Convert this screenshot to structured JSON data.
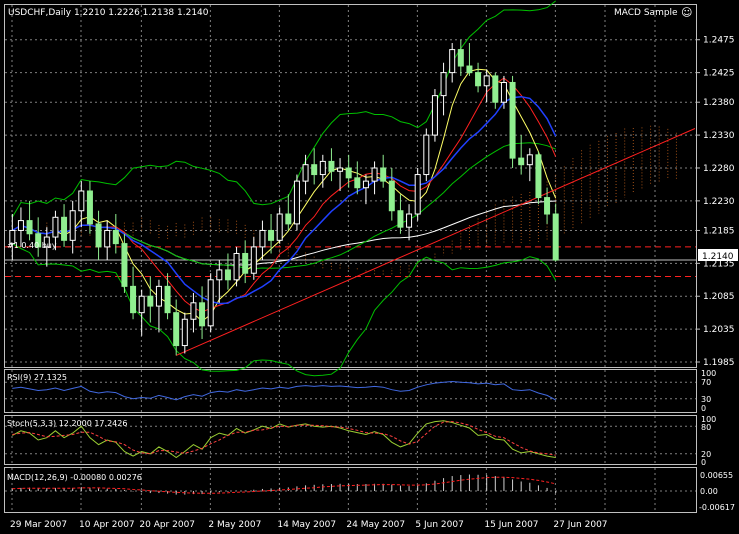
{
  "header": {
    "symbol_line": "USDCHF,Daily  1.2210 1.2226 1.2138 1.2140",
    "expert": "MACD Sample",
    "smiley": "☺"
  },
  "annotation": "#1 0.40 buy",
  "price_tag": "1.2140",
  "panes": {
    "rsi": {
      "label": "RSI(9) 27.1325",
      "ticks": [
        "100",
        "70",
        "30",
        "0"
      ]
    },
    "stoch": {
      "label": "Stoch(5,3,3) 12.2000 17.2426",
      "ticks": [
        "100",
        "80",
        "20",
        "0"
      ]
    },
    "macd": {
      "label": "MACD(12,26,9) -0.00080 0.00276",
      "ticks": [
        "0.00655",
        "0.00",
        "-0.00617"
      ]
    }
  },
  "colors": {
    "bull_candle": "#ffffff",
    "bear_candle": "#90ee90",
    "frame": "#c0c0c0",
    "grid": "#808080",
    "bollinger": "#00c000",
    "ma_white": "#ffffff",
    "ma_yellow": "#ffff66",
    "ma_red": "#ff2020",
    "ma_blue": "#2040ff",
    "kumo": "#d2691e",
    "rsi_line": "#4169e1",
    "stoch_main": "#9acd32",
    "stoch_signal": "#ff4040"
  },
  "chart_data": {
    "type": "candlestick",
    "ylim": [
      1.1985,
      1.2505
    ],
    "y_ticks": [
      "1.2475",
      "1.2425",
      "1.2380",
      "1.2330",
      "1.2280",
      "1.2230",
      "1.2185",
      "1.2135",
      "1.2085",
      "1.2035",
      "1.1985"
    ],
    "x_ticks": [
      "29 Mar 2007",
      "10 Apr 2007",
      "20 Apr 2007",
      "2 May 2007",
      "14 May 2007",
      "24 May 2007",
      "5 Jun 2007",
      "15 Jun 2007",
      "27 Jun 2007"
    ],
    "candles": [
      {
        "o": 1.2165,
        "h": 1.221,
        "l": 1.214,
        "c": 1.2185
      },
      {
        "o": 1.2185,
        "h": 1.222,
        "l": 1.216,
        "c": 1.22
      },
      {
        "o": 1.22,
        "h": 1.223,
        "l": 1.217,
        "c": 1.218
      },
      {
        "o": 1.218,
        "h": 1.2205,
        "l": 1.2145,
        "c": 1.216
      },
      {
        "o": 1.216,
        "h": 1.219,
        "l": 1.213,
        "c": 1.2175
      },
      {
        "o": 1.2175,
        "h": 1.2215,
        "l": 1.2155,
        "c": 1.2205
      },
      {
        "o": 1.2205,
        "h": 1.2225,
        "l": 1.216,
        "c": 1.217
      },
      {
        "o": 1.217,
        "h": 1.223,
        "l": 1.215,
        "c": 1.2215
      },
      {
        "o": 1.2215,
        "h": 1.226,
        "l": 1.219,
        "c": 1.2245
      },
      {
        "o": 1.2245,
        "h": 1.226,
        "l": 1.218,
        "c": 1.2195
      },
      {
        "o": 1.2195,
        "h": 1.2215,
        "l": 1.214,
        "c": 1.216
      },
      {
        "o": 1.216,
        "h": 1.22,
        "l": 1.214,
        "c": 1.2185
      },
      {
        "o": 1.2185,
        "h": 1.221,
        "l": 1.215,
        "c": 1.2165
      },
      {
        "o": 1.2165,
        "h": 1.218,
        "l": 1.209,
        "c": 1.21
      },
      {
        "o": 1.21,
        "h": 1.213,
        "l": 1.205,
        "c": 1.206
      },
      {
        "o": 1.206,
        "h": 1.2095,
        "l": 1.2025,
        "c": 1.2085
      },
      {
        "o": 1.2085,
        "h": 1.2115,
        "l": 1.2045,
        "c": 1.207
      },
      {
        "o": 1.207,
        "h": 1.211,
        "l": 1.203,
        "c": 1.21
      },
      {
        "o": 1.21,
        "h": 1.212,
        "l": 1.205,
        "c": 1.206
      },
      {
        "o": 1.206,
        "h": 1.208,
        "l": 1.1995,
        "c": 1.201
      },
      {
        "o": 1.201,
        "h": 1.206,
        "l": 1.1998,
        "c": 1.205
      },
      {
        "o": 1.205,
        "h": 1.209,
        "l": 1.203,
        "c": 1.2075
      },
      {
        "o": 1.2075,
        "h": 1.21,
        "l": 1.202,
        "c": 1.204
      },
      {
        "o": 1.204,
        "h": 1.212,
        "l": 1.203,
        "c": 1.211
      },
      {
        "o": 1.211,
        "h": 1.214,
        "l": 1.2075,
        "c": 1.2125
      },
      {
        "o": 1.2125,
        "h": 1.215,
        "l": 1.2095,
        "c": 1.211
      },
      {
        "o": 1.211,
        "h": 1.216,
        "l": 1.21,
        "c": 1.215
      },
      {
        "o": 1.215,
        "h": 1.217,
        "l": 1.2105,
        "c": 1.212
      },
      {
        "o": 1.212,
        "h": 1.2175,
        "l": 1.211,
        "c": 1.216
      },
      {
        "o": 1.216,
        "h": 1.22,
        "l": 1.214,
        "c": 1.2185
      },
      {
        "o": 1.2185,
        "h": 1.221,
        "l": 1.215,
        "c": 1.217
      },
      {
        "o": 1.217,
        "h": 1.222,
        "l": 1.2165,
        "c": 1.221
      },
      {
        "o": 1.221,
        "h": 1.224,
        "l": 1.2185,
        "c": 1.2195
      },
      {
        "o": 1.2195,
        "h": 1.227,
        "l": 1.2185,
        "c": 1.226
      },
      {
        "o": 1.226,
        "h": 1.23,
        "l": 1.224,
        "c": 1.2285
      },
      {
        "o": 1.2285,
        "h": 1.231,
        "l": 1.2255,
        "c": 1.227
      },
      {
        "o": 1.227,
        "h": 1.23,
        "l": 1.225,
        "c": 1.229
      },
      {
        "o": 1.229,
        "h": 1.231,
        "l": 1.226,
        "c": 1.2275
      },
      {
        "o": 1.2275,
        "h": 1.2295,
        "l": 1.2245,
        "c": 1.228
      },
      {
        "o": 1.228,
        "h": 1.23,
        "l": 1.225,
        "c": 1.2265
      },
      {
        "o": 1.2265,
        "h": 1.229,
        "l": 1.224,
        "c": 1.225
      },
      {
        "o": 1.225,
        "h": 1.227,
        "l": 1.2225,
        "c": 1.226
      },
      {
        "o": 1.226,
        "h": 1.229,
        "l": 1.224,
        "c": 1.228
      },
      {
        "o": 1.228,
        "h": 1.23,
        "l": 1.225,
        "c": 1.226
      },
      {
        "o": 1.226,
        "h": 1.228,
        "l": 1.22,
        "c": 1.2215
      },
      {
        "o": 1.2215,
        "h": 1.224,
        "l": 1.218,
        "c": 1.219
      },
      {
        "o": 1.219,
        "h": 1.2225,
        "l": 1.217,
        "c": 1.221
      },
      {
        "o": 1.221,
        "h": 1.228,
        "l": 1.22,
        "c": 1.227
      },
      {
        "o": 1.227,
        "h": 1.234,
        "l": 1.226,
        "c": 1.233
      },
      {
        "o": 1.233,
        "h": 1.24,
        "l": 1.232,
        "c": 1.239
      },
      {
        "o": 1.239,
        "h": 1.244,
        "l": 1.236,
        "c": 1.2425
      },
      {
        "o": 1.2425,
        "h": 1.247,
        "l": 1.241,
        "c": 1.246
      },
      {
        "o": 1.246,
        "h": 1.2475,
        "l": 1.242,
        "c": 1.2435
      },
      {
        "o": 1.2435,
        "h": 1.247,
        "l": 1.242,
        "c": 1.2425
      },
      {
        "o": 1.2425,
        "h": 1.244,
        "l": 1.2395,
        "c": 1.2405
      },
      {
        "o": 1.2405,
        "h": 1.243,
        "l": 1.238,
        "c": 1.242
      },
      {
        "o": 1.242,
        "h": 1.2425,
        "l": 1.237,
        "c": 1.238
      },
      {
        "o": 1.238,
        "h": 1.242,
        "l": 1.237,
        "c": 1.241
      },
      {
        "o": 1.241,
        "h": 1.242,
        "l": 1.228,
        "c": 1.2295
      },
      {
        "o": 1.2295,
        "h": 1.233,
        "l": 1.227,
        "c": 1.2285
      },
      {
        "o": 1.2285,
        "h": 1.231,
        "l": 1.226,
        "c": 1.23
      },
      {
        "o": 1.23,
        "h": 1.2305,
        "l": 1.2225,
        "c": 1.2235
      },
      {
        "o": 1.2235,
        "h": 1.225,
        "l": 1.2195,
        "c": 1.221
      },
      {
        "o": 1.221,
        "h": 1.2226,
        "l": 1.2138,
        "c": 1.214
      }
    ],
    "rsi": [
      55,
      58,
      54,
      50,
      52,
      56,
      50,
      55,
      60,
      48,
      44,
      47,
      45,
      35,
      30,
      33,
      31,
      38,
      33,
      27,
      35,
      40,
      36,
      45,
      48,
      46,
      52,
      48,
      52,
      56,
      54,
      58,
      55,
      60,
      62,
      60,
      62,
      60,
      61,
      59,
      57,
      58,
      60,
      58,
      52,
      48,
      50,
      58,
      64,
      68,
      70,
      72,
      70,
      69,
      66,
      68,
      64,
      66,
      52,
      50,
      52,
      44,
      38,
      27
    ],
    "stoch_main": [
      60,
      70,
      65,
      50,
      55,
      70,
      55,
      65,
      80,
      55,
      40,
      50,
      45,
      25,
      15,
      25,
      20,
      35,
      25,
      12,
      25,
      40,
      30,
      55,
      65,
      60,
      75,
      65,
      72,
      80,
      75,
      85,
      78,
      82,
      85,
      80,
      78,
      80,
      76,
      70,
      66,
      62,
      68,
      62,
      45,
      35,
      42,
      65,
      85,
      90,
      92,
      88,
      82,
      76,
      60,
      62,
      52,
      50,
      30,
      22,
      25,
      20,
      15,
      12
    ],
    "stoch_signal": [
      62,
      65,
      66,
      62,
      57,
      58,
      60,
      62,
      67,
      67,
      58,
      48,
      46,
      40,
      28,
      22,
      20,
      27,
      27,
      24,
      21,
      26,
      32,
      42,
      50,
      60,
      67,
      67,
      71,
      72,
      76,
      80,
      79,
      82,
      82,
      82,
      81,
      79,
      78,
      75,
      71,
      66,
      65,
      64,
      58,
      48,
      41,
      47,
      64,
      80,
      89,
      90,
      87,
      82,
      73,
      66,
      58,
      55,
      44,
      34,
      26,
      22,
      20,
      17
    ],
    "macd_hist": [
      0.001,
      0.0012,
      0.0013,
      0.0012,
      0.0011,
      0.0012,
      0.0011,
      0.0012,
      0.0015,
      0.0013,
      0.001,
      0.0009,
      0.0008,
      0.0004,
      -0.0002,
      -0.0005,
      -0.0008,
      -0.0008,
      -0.001,
      -0.0014,
      -0.0014,
      -0.0012,
      -0.0012,
      -0.0008,
      -0.0005,
      -0.0003,
      0.0001,
      0.0002,
      0.0005,
      0.0008,
      0.001,
      0.0013,
      0.0014,
      0.0018,
      0.0022,
      0.0024,
      0.0026,
      0.0027,
      0.0028,
      0.0028,
      0.0027,
      0.0027,
      0.0028,
      0.0028,
      0.0025,
      0.0021,
      0.0019,
      0.0022,
      0.003,
      0.004,
      0.005,
      0.0058,
      0.0062,
      0.0064,
      0.0063,
      0.0062,
      0.0058,
      0.0055,
      0.0045,
      0.0037,
      0.0032,
      0.0022,
      0.0012,
      -0.0008
    ],
    "macd_signal": [
      0.0009,
      0.001,
      0.0011,
      0.0011,
      0.0011,
      0.0011,
      0.0011,
      0.0011,
      0.0012,
      0.0012,
      0.0012,
      0.0011,
      0.001,
      0.0009,
      0.0006,
      0.0004,
      0.0001,
      -0.0001,
      -0.0003,
      -0.0005,
      -0.0007,
      -0.0008,
      -0.0009,
      -0.0009,
      -0.0008,
      -0.0007,
      -0.0005,
      -0.0004,
      -0.0002,
      0.0,
      0.0002,
      0.0004,
      0.0006,
      0.0008,
      0.0011,
      0.0013,
      0.0016,
      0.0018,
      0.002,
      0.0021,
      0.0022,
      0.0023,
      0.0024,
      0.0025,
      0.0025,
      0.0024,
      0.0023,
      0.0023,
      0.0024,
      0.0027,
      0.0032,
      0.0037,
      0.0042,
      0.0046,
      0.0049,
      0.0052,
      0.0053,
      0.0053,
      0.0052,
      0.0049,
      0.0046,
      0.0041,
      0.0035,
      0.0028
    ]
  }
}
